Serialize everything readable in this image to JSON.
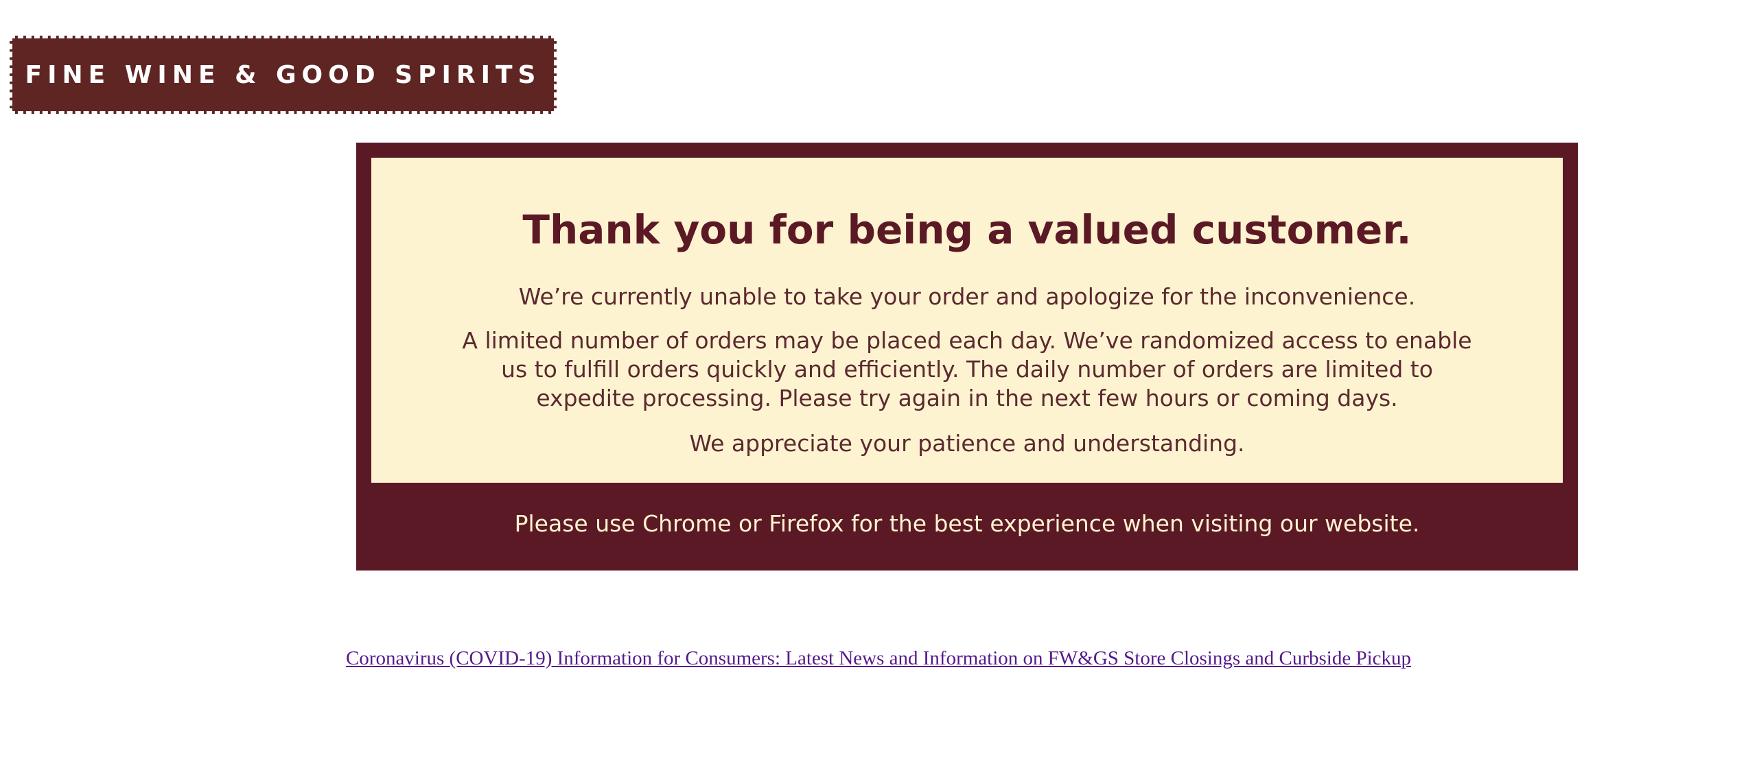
{
  "header": {
    "logo_text": "FINE WINE & GOOD SPIRITS"
  },
  "notice": {
    "headline": "Thank you for being a valued customer.",
    "line1": "We’re currently unable to take your order and apologize for the inconvenience.",
    "line2": "A limited number of orders may be placed each day. We’ve randomized access to enable us to fulfill orders quickly and efficiently. The daily number of orders are limited to expedite processing. Please try again in the next few hours or coming days.",
    "line3": "We appreciate your patience and understanding.",
    "browser_note": "Please use Chrome or Firefox for the best experience when visiting our website."
  },
  "footer": {
    "covid_link_text": "Coronavirus (COVID-19) Information for Consumers: Latest News and Information on FW&GS Store Closings and Curbside Pickup"
  },
  "colors": {
    "brand_maroon": "#5b1925",
    "logo_brown": "#5e2523",
    "notice_background": "#fdf3d0",
    "link_visited": "#551a8b"
  }
}
